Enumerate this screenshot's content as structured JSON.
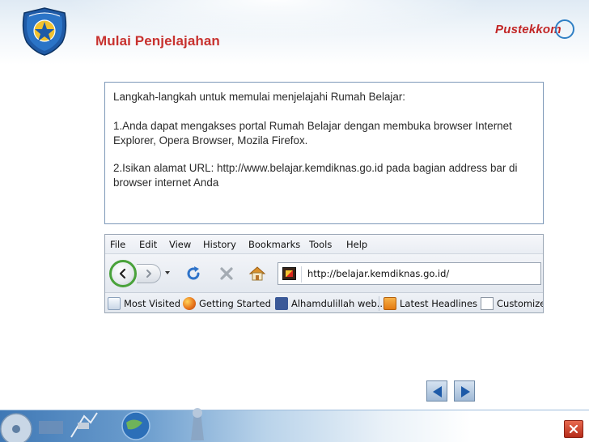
{
  "slide": {
    "title": "Mulai Penjelajahan",
    "brand": "Pustekkom"
  },
  "content": {
    "paragraphs": [
      "Langkah-langkah untuk memulai menjelajahi Rumah Belajar:",
      "1.Anda dapat mengakses portal Rumah Belajar dengan membuka browser Internet  Explorer, Opera Browser, Mozila Firefox.",
      "2.Isikan alamat URL: http://www.belajar.kemdiknas.go.id pada bagian address bar di browser internet Anda"
    ]
  },
  "browser": {
    "menu": [
      "File",
      "Edit",
      "View",
      "History",
      "Bookmarks",
      "Tools",
      "Help"
    ],
    "url": "http://belajar.kemdiknas.go.id/",
    "bookmarks": [
      "Most Visited",
      "Getting Started",
      "Alhamdulillah web...",
      "Latest Headlines",
      "Customize"
    ]
  },
  "icons": {
    "logo": "kemdiknas-logo-icon",
    "back": "back-arrow-icon",
    "forward": "forward-arrow-icon",
    "reload": "reload-icon",
    "stop": "stop-icon",
    "home": "home-icon",
    "prev_slide": "triangle-left-icon",
    "next_slide": "triangle-right-icon",
    "close": "close-icon"
  },
  "colors": {
    "title": "#c8322f",
    "panel_border": "#7d98b8",
    "back_ring": "#49a23a",
    "close": "#c0392b"
  }
}
